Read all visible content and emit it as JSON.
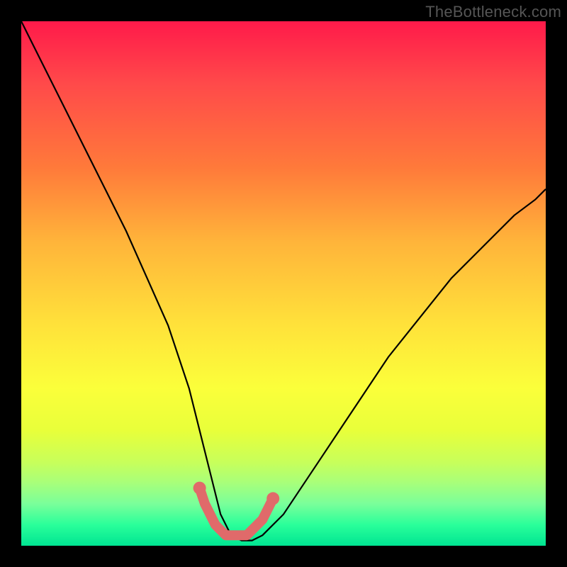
{
  "watermark": "TheBottleneck.com",
  "chart_data": {
    "type": "line",
    "title": "",
    "xlabel": "",
    "ylabel": "",
    "xlim": [
      0,
      100
    ],
    "ylim": [
      0,
      100
    ],
    "series": [
      {
        "name": "bottleneck-curve",
        "x": [
          0,
          4,
          8,
          12,
          16,
          20,
          24,
          28,
          32,
          34,
          36,
          38,
          40,
          42,
          44,
          46,
          50,
          54,
          58,
          62,
          66,
          70,
          74,
          78,
          82,
          86,
          90,
          94,
          98,
          100
        ],
        "values": [
          100,
          92,
          84,
          76,
          68,
          60,
          51,
          42,
          30,
          22,
          14,
          6,
          2,
          1,
          1,
          2,
          6,
          12,
          18,
          24,
          30,
          36,
          41,
          46,
          51,
          55,
          59,
          63,
          66,
          68
        ]
      },
      {
        "name": "optimal-highlight",
        "x": [
          34,
          35,
          36,
          37,
          38,
          39,
          40,
          41,
          42,
          43,
          44,
          45,
          46,
          47,
          48
        ],
        "values": [
          11,
          8,
          6,
          4,
          3,
          2,
          2,
          2,
          2,
          2,
          3,
          4,
          5,
          7,
          9
        ]
      }
    ],
    "colors": {
      "curve": "#000000",
      "highlight": "#e06a6a"
    }
  }
}
